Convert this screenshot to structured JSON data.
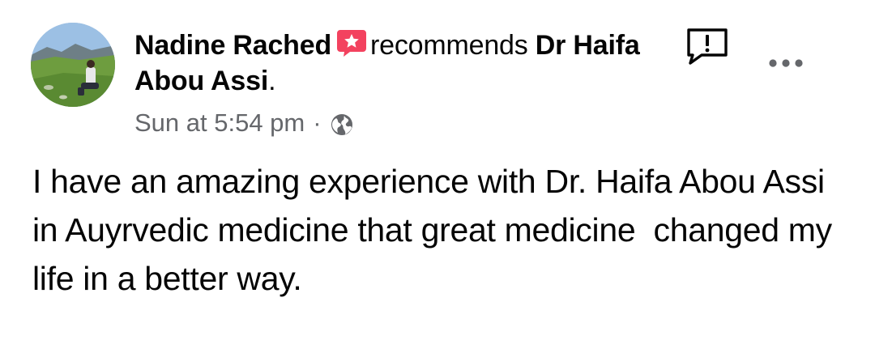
{
  "post": {
    "author": "Nadine Rached",
    "verb": "recommends",
    "target": "Dr Haifa Abou Assi",
    "target_suffix": ".",
    "timestamp": "Sun at 5:54 pm",
    "separator": "·",
    "audience_icon": "globe-icon",
    "badge_icon": "recommendation-badge-icon",
    "badge_color": "#f3425f",
    "body": "I have an amazing experience with Dr. Haifa Abou Assi in Auyrvedic medicine that great medicine  changed my life in a better way."
  },
  "actions": {
    "report_icon": "report-icon",
    "more_icon": "more-options-icon"
  },
  "colors": {
    "text": "#050505",
    "secondary": "#65676b",
    "background": "#ffffff"
  }
}
